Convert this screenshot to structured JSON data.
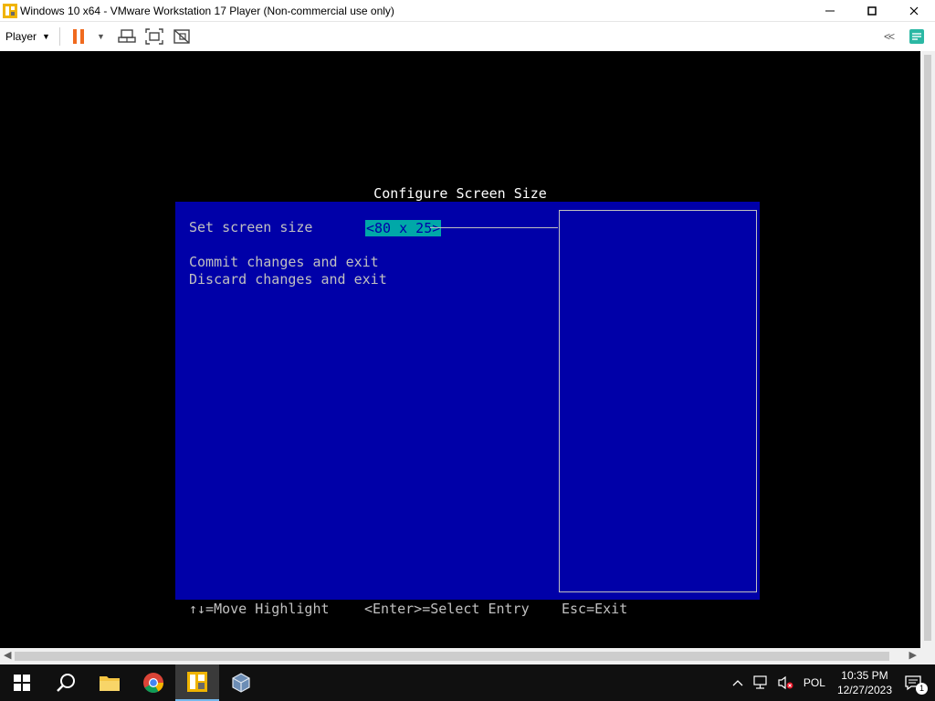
{
  "window": {
    "title": "Windows 10 x64 - VMware Workstation 17 Player (Non-commercial use only)",
    "minimize_icon": "minimize-icon",
    "maximize_icon": "maximize-icon",
    "close_icon": "close-icon"
  },
  "toolbar": {
    "player_label": "Player",
    "icons": [
      "pause-icon",
      "send-ctrl-alt-del-icon",
      "fullscreen-icon",
      "unity-icon"
    ],
    "collapse_label": "<<"
  },
  "vm_screen": {
    "title": "Configure Screen Size",
    "setting_label": "Set screen size",
    "setting_value": "<80 x 25>",
    "commit_label": "Commit changes and exit",
    "discard_label": "Discard changes and exit",
    "footer": {
      "move": "↑↓=Move Highlight",
      "select": "<Enter>=Select Entry",
      "exit": "Esc=Exit"
    },
    "colors": {
      "background": "#000000",
      "panel": "#0000a8",
      "text": "#c0c0c0",
      "highlight": "#00a8a8"
    }
  },
  "taskbar": {
    "apps": [
      "windows-start-icon",
      "search-icon",
      "file-explorer-icon",
      "chrome-icon",
      "vmware-player-icon",
      "virtualbox-icon"
    ],
    "tray": {
      "language": "POL",
      "time": "10:35 PM",
      "date": "12/27/2023",
      "notification_count": "1"
    }
  }
}
